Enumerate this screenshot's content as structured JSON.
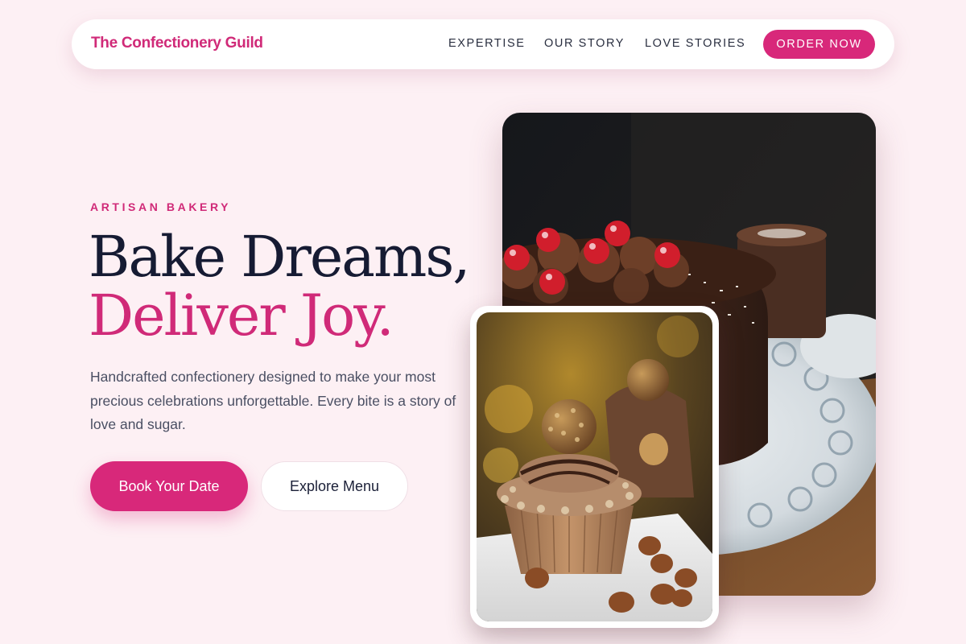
{
  "nav": {
    "brand": "The Confectionery Guild",
    "links": [
      "EXPERTISE",
      "OUR STORY",
      "LOVE STORIES"
    ],
    "cta": "ORDER NOW"
  },
  "hero": {
    "eyebrow": "ARTISAN BAKERY",
    "headline_line1": "Bake Dreams,",
    "headline_line2": "Deliver Joy.",
    "description": "Handcrafted confectionery designed to make your most precious celebrations unforgettable. Every bite is a story of love and sugar.",
    "primary_button": "Book Your Date",
    "secondary_button": "Explore Menu"
  },
  "images": {
    "large": "chocolate-cake-with-cherries-photo",
    "small": "hazelnut-chocolate-cupcake-photo"
  },
  "colors": {
    "brand": "#d02a78",
    "button": "#d8287a",
    "background": "#fdf0f4",
    "heading": "#161b33"
  }
}
